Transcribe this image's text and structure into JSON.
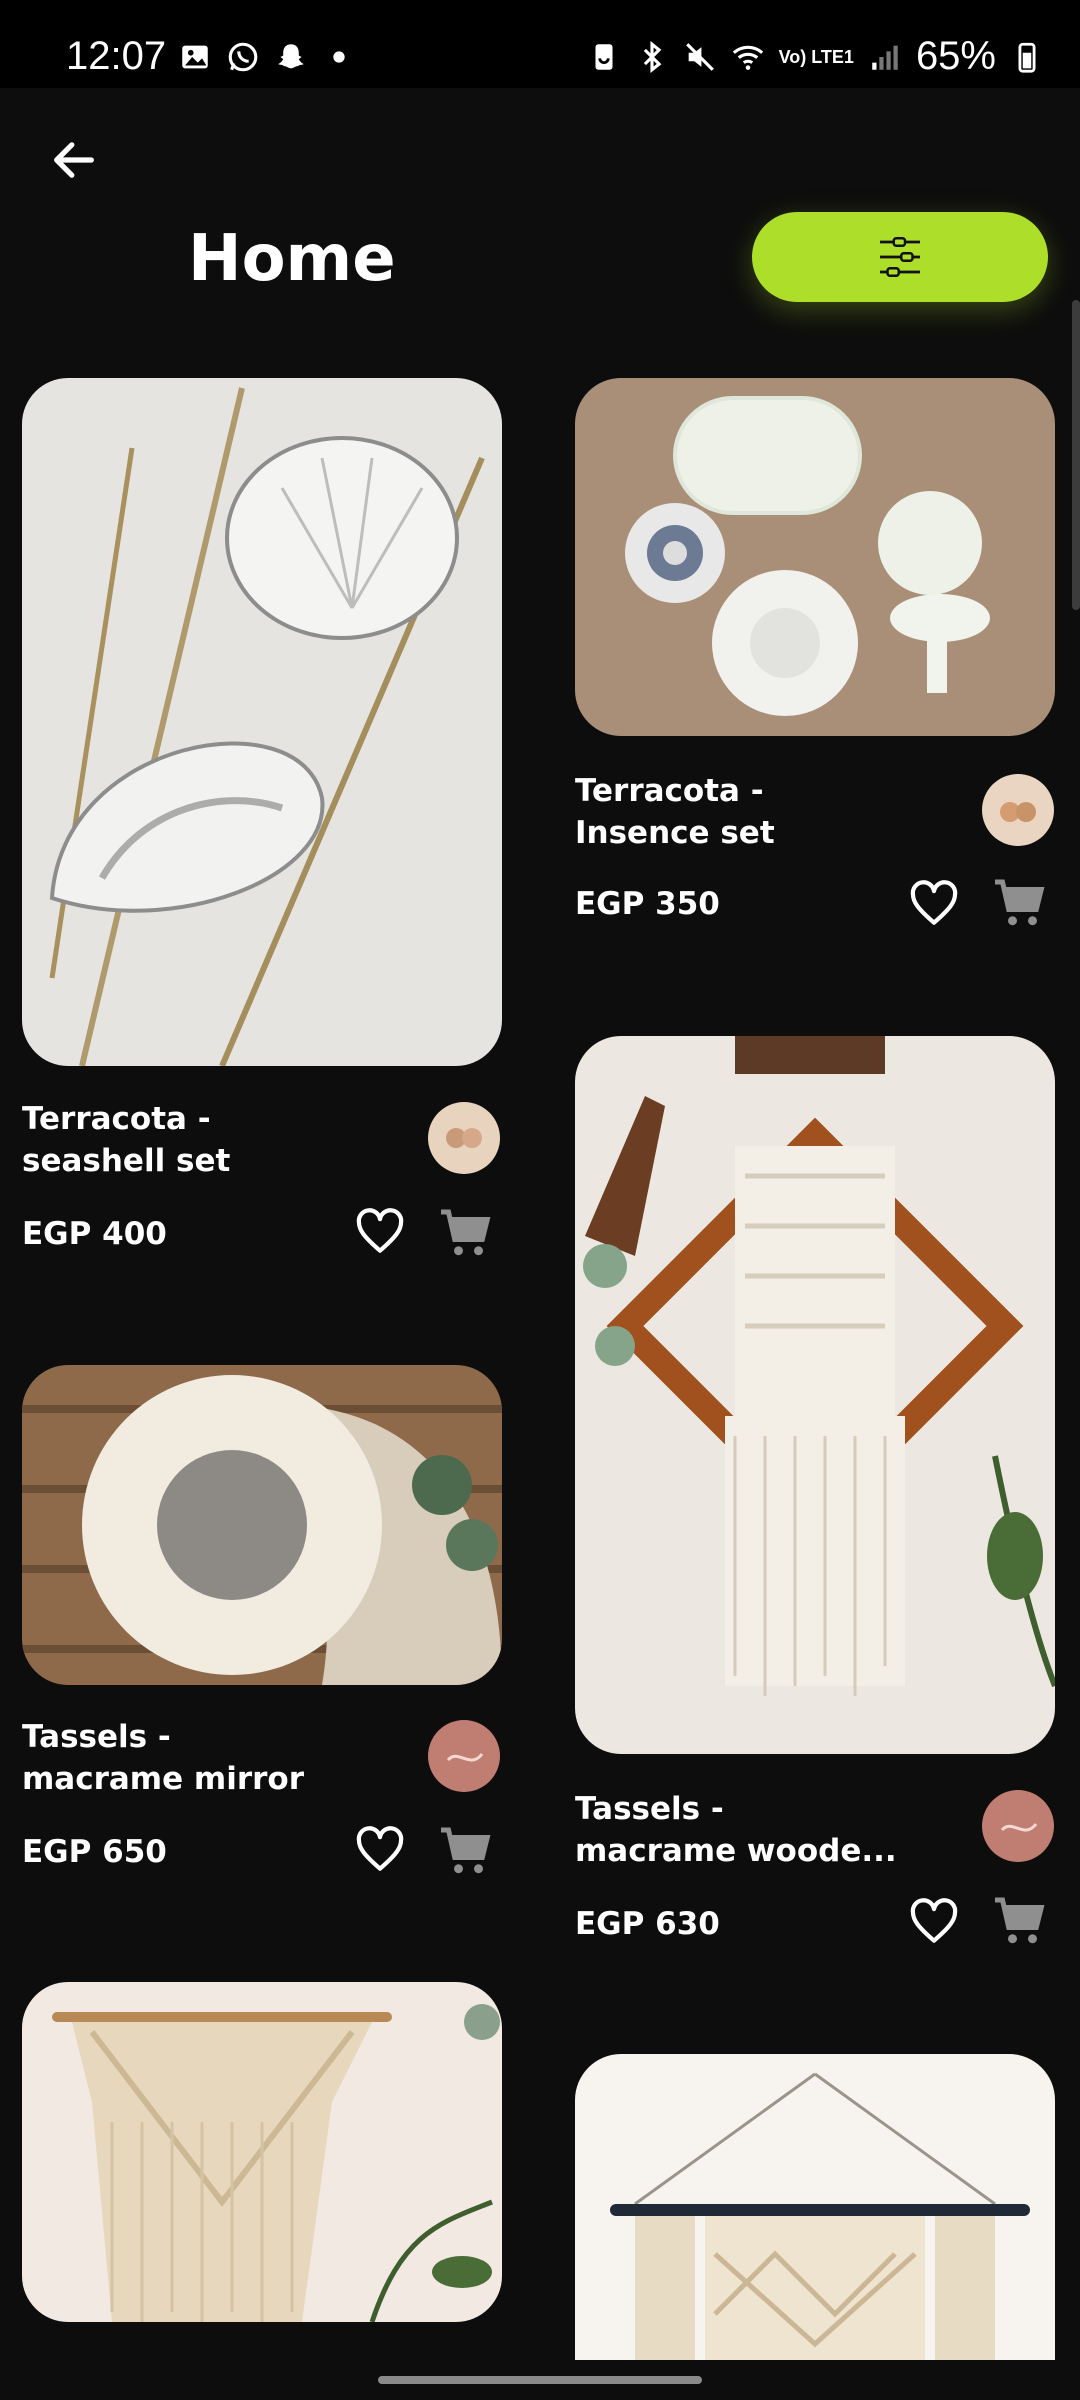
{
  "status_bar": {
    "time": "12:07",
    "network_label": "Vo) LTE1",
    "battery": "65%"
  },
  "header": {
    "title": "Home",
    "back_icon": "arrow-left-icon",
    "filter_icon": "sliders-icon",
    "accent": "#acde2a"
  },
  "products": [
    {
      "title_line1": "Terracota -",
      "title_line2": "seashell set",
      "price": "EGP 400"
    },
    {
      "title_line1": "Terracota -",
      "title_line2": "Insence set",
      "price": "EGP 350"
    },
    {
      "title_line1": "Tassels -",
      "title_line2": "macrame mirror",
      "price": "EGP 650"
    },
    {
      "title_line1": "Tassels -",
      "title_line2": "macrame woode...",
      "price": "EGP 630"
    }
  ],
  "icons": {
    "favorite": "heart-outline-icon",
    "cart": "cart-icon"
  }
}
